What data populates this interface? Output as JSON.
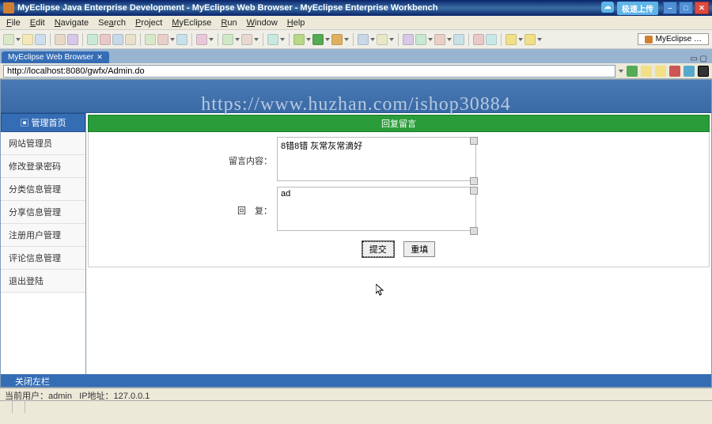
{
  "titlebar": {
    "text": "MyEclipse Java Enterprise Development - MyEclipse Web Browser - MyEclipse Enterprise Workbench",
    "upload_badge": "极速上传"
  },
  "menubar": [
    "File",
    "Edit",
    "Navigate",
    "Search",
    "Project",
    "MyEclipse",
    "Run",
    "Window",
    "Help"
  ],
  "quicklaunch_tab": "MyEclipse …",
  "browser_tab": {
    "title": "MyEclipse Web Browser",
    "close": "✕"
  },
  "url": "http://localhost:8080/gwfx/Admin.do",
  "watermark": "https://www.huzhan.com/ishop30884",
  "sidebar": {
    "header": "▣ 管理首页",
    "items": [
      "网站管理员",
      "修改登录密码",
      "分类信息管理",
      "分享信息管理",
      "注册用户管理",
      "评论信息管理",
      "退出登陆"
    ]
  },
  "panel": {
    "header": "回复留言",
    "rows": {
      "content_label": "留言内容：",
      "content_value": "8错8错 灰常灰常滴好",
      "reply_label": "回　复：",
      "reply_value": "ad"
    },
    "buttons": {
      "submit": "提交",
      "reset": "重填"
    }
  },
  "collapse_bar": "关闭左栏",
  "status": {
    "user_label": "当前用户：",
    "user": "admin",
    "ip_label": "IP地址：",
    "ip": "127.0.0.1"
  }
}
